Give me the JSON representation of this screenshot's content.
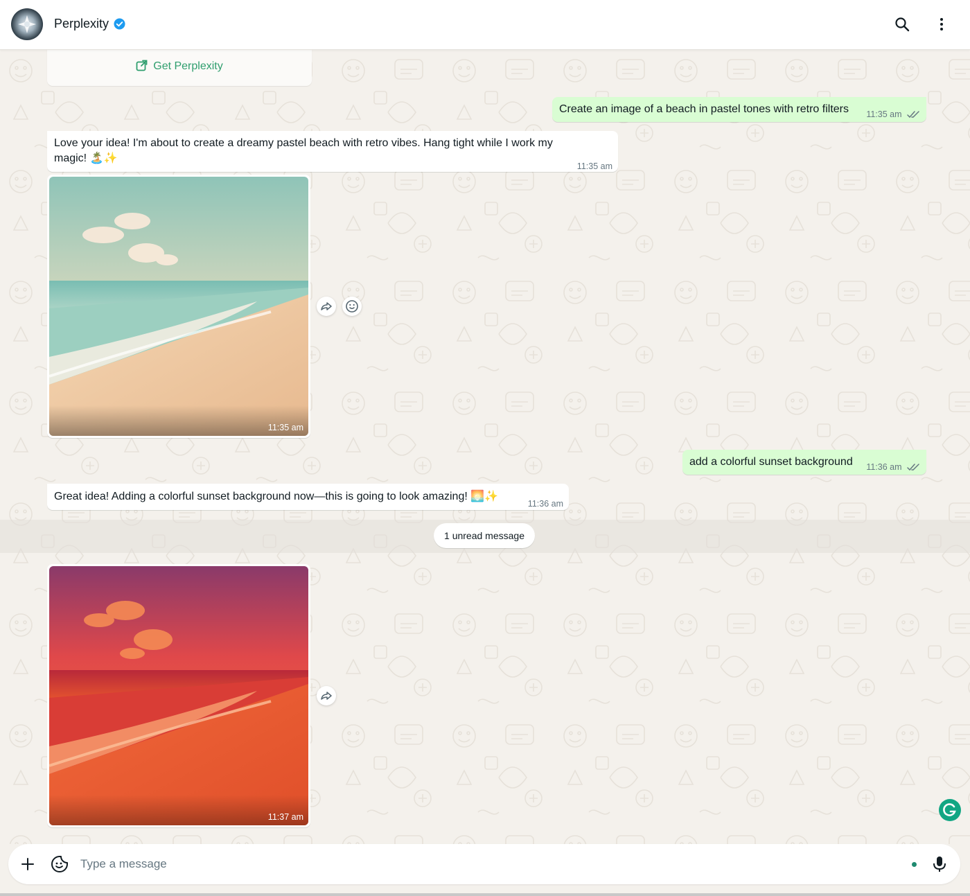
{
  "header": {
    "contact_name": "Perplexity",
    "verified": true,
    "icons": [
      "search-icon",
      "more-vertical-icon"
    ]
  },
  "banner": {
    "link_label": "Get Perplexity",
    "icon": "external-link-icon"
  },
  "messages": [
    {
      "direction": "outgoing",
      "text": "Create an image of a beach in pastel tones with retro filters",
      "time": "11:35 am",
      "status": "read"
    },
    {
      "direction": "incoming",
      "text": "Love your idea! I'm about to create a dreamy pastel beach with retro vibes. Hang tight while I work my magic! 🏝️✨",
      "time": "11:35 am"
    },
    {
      "direction": "incoming",
      "type": "image",
      "description": "pastel beach",
      "time": "11:35 am"
    },
    {
      "direction": "outgoing",
      "text": "add a colorful sunset background",
      "time": "11:36 am",
      "status": "read"
    },
    {
      "direction": "incoming",
      "text": "Great idea! Adding a colorful sunset background now—this is going to look amazing! 🌅✨",
      "time": "11:36 am"
    },
    {
      "direction": "incoming",
      "type": "image",
      "description": "sunset beach",
      "time": "11:37 am"
    }
  ],
  "unread_divider": "1 unread message",
  "composer": {
    "placeholder": "Type a message",
    "icons": [
      "plus-icon",
      "sticker-icon",
      "mic-icon"
    ]
  },
  "colors": {
    "outgoing_bubble": "#d9fdd3",
    "incoming_bubble": "#ffffff",
    "background": "#f4f1ec",
    "accent": "#2f9e6e"
  }
}
